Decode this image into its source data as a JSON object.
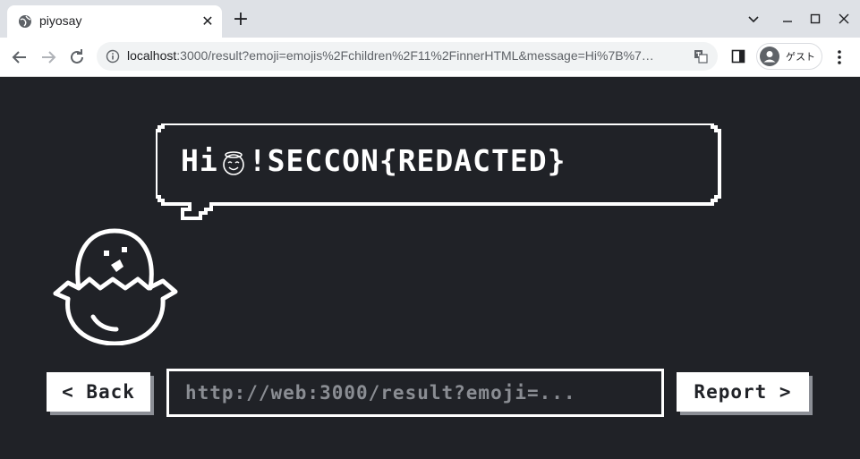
{
  "browser": {
    "tab_title": "piyosay",
    "url_host": "localhost",
    "url_rest": ":3000/result?emoji=emojis%2Fchildren%2F11%2FinnerHTML&message=Hi%7B%7…",
    "profile_label": "ゲスト",
    "icons": {
      "tab": "globe-icon",
      "back": "arrow-left-icon",
      "forward": "arrow-right-icon",
      "reload": "reload-icon",
      "site_info": "info-icon",
      "translate": "translate-icon",
      "side_panel": "side-panel-icon",
      "menu": "kebab-menu-icon"
    }
  },
  "page": {
    "message_prefix": "Hi",
    "emoji_name": "smiling-face-with-halo",
    "message_suffix": "!SECCON{REDACTED}",
    "back_label": "< Back",
    "report_label": "Report >",
    "share_url_placeholder": "http://web:3000/result?emoji=..."
  },
  "colors": {
    "page_background": "#202227",
    "foreground": "#ffffff",
    "button_shadow": "#8c8f96",
    "placeholder_text": "#8a8d93"
  }
}
